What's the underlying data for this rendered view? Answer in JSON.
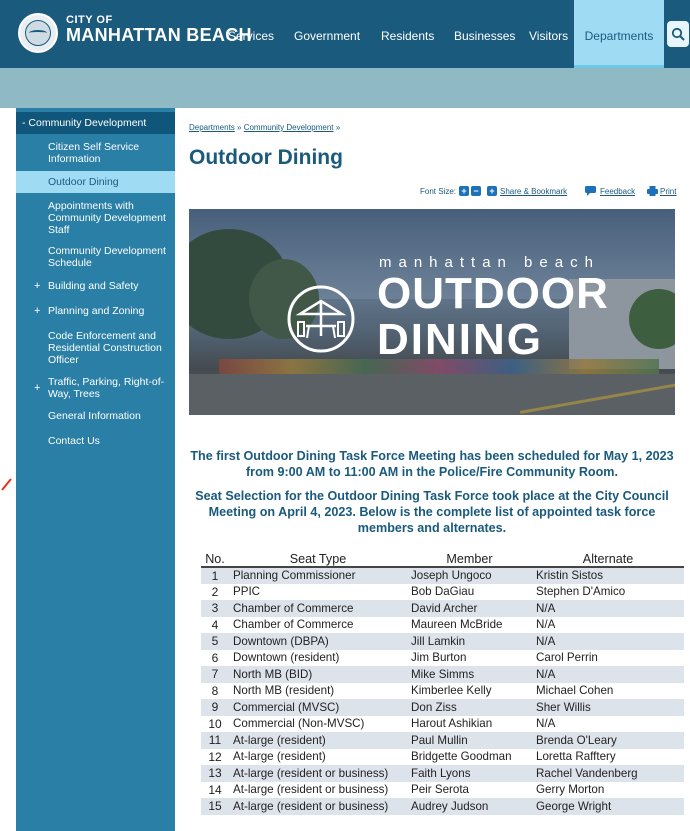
{
  "header": {
    "logo_small": "CITY OF",
    "logo_large": "MANHATTAN BEACH",
    "nav": [
      "Services",
      "Government",
      "Residents",
      "Businesses",
      "Visitors"
    ],
    "nav_active": "Departments",
    "search_icon": "search-icon",
    "seal_icon": "city-seal-icon",
    "colors": {
      "bar": "#1a5a7d",
      "active": "#9fdcf4",
      "band": "#8fb9c4"
    }
  },
  "sidebar": {
    "section": "- Community Development",
    "items": [
      {
        "label": "Citizen Self Service Information",
        "expandable": false,
        "active": false
      },
      {
        "label": "Outdoor Dining",
        "expandable": false,
        "active": true
      },
      {
        "label": "Appointments with Community Development Staff",
        "expandable": false,
        "active": false
      },
      {
        "label": "Community Development Schedule",
        "expandable": false,
        "active": false
      },
      {
        "label": "Building and Safety",
        "expandable": true,
        "active": false
      },
      {
        "label": "Planning and Zoning",
        "expandable": true,
        "active": false
      },
      {
        "label": "Code Enforcement and Residential Construction Officer",
        "expandable": false,
        "active": false
      },
      {
        "label": "Traffic, Parking, Right-of-Way, Trees",
        "expandable": true,
        "active": false
      },
      {
        "label": "General Information",
        "expandable": false,
        "active": false
      },
      {
        "label": "Contact Us",
        "expandable": false,
        "active": false
      }
    ],
    "plus_symbol": "+"
  },
  "main": {
    "breadcrumb": {
      "part1": "Departments",
      "sep1": " » ",
      "part2": "Community Development",
      "sep2": " »"
    },
    "title": "Outdoor Dining",
    "tools": {
      "font_size_label": "Font Size:",
      "increase": "+",
      "decrease": "−",
      "share": "Share & Bookmark",
      "feedback": "Feedback",
      "print": "Print"
    },
    "hero": {
      "subtitle": "manhattan beach",
      "line1": "OUTDOOR",
      "line2": "DINING"
    },
    "announcement1": "The first Outdoor Dining Task Force Meeting has been scheduled for May 1, 2023 from 9:00 AM to 11:00 AM in the Police/Fire Community Room.",
    "announcement2": "Seat Selection for the Outdoor Dining Task Force took place at the City Council Meeting on April 4, 2023. Below is the complete list of appointed task force members and alternates.",
    "table": {
      "headers": [
        "No.",
        "Seat Type",
        "Member",
        "Alternate"
      ],
      "rows": [
        [
          "1",
          "Planning Commissioner",
          "Joseph Ungoco",
          "Kristin Sistos"
        ],
        [
          "2",
          "PPIC",
          "Bob DaGiau",
          "Stephen D'Amico"
        ],
        [
          "3",
          "Chamber of Commerce",
          "David Archer",
          "N/A"
        ],
        [
          "4",
          "Chamber of Commerce",
          "Maureen McBride",
          "N/A"
        ],
        [
          "5",
          "Downtown (DBPA)",
          "Jill Lamkin",
          "N/A"
        ],
        [
          "6",
          "Downtown (resident)",
          "Jim Burton",
          "Carol Perrin"
        ],
        [
          "7",
          "North MB (BID)",
          "Mike Simms",
          "N/A"
        ],
        [
          "8",
          "North MB (resident)",
          "Kimberlee Kelly",
          "Michael Cohen"
        ],
        [
          "9",
          "Commercial (MVSC)",
          "Don Ziss",
          "Sher Willis"
        ],
        [
          "10",
          "Commercial (Non-MVSC)",
          "Harout Ashikian",
          "N/A"
        ],
        [
          "11",
          "At-large (resident)",
          "Paul Mullin",
          "Brenda O'Leary"
        ],
        [
          "12",
          "At-large (resident)",
          "Bridgette Goodman",
          "Loretta Rafftery"
        ],
        [
          "13",
          "At-large (resident or business)",
          "Faith Lyons",
          "Rachel Vandenberg"
        ],
        [
          "14",
          "At-large (resident or business)",
          "Peir Serota",
          "Gerry Morton"
        ],
        [
          "15",
          "At-large (resident or business)",
          "Audrey Judson",
          "George Wright"
        ]
      ]
    }
  }
}
